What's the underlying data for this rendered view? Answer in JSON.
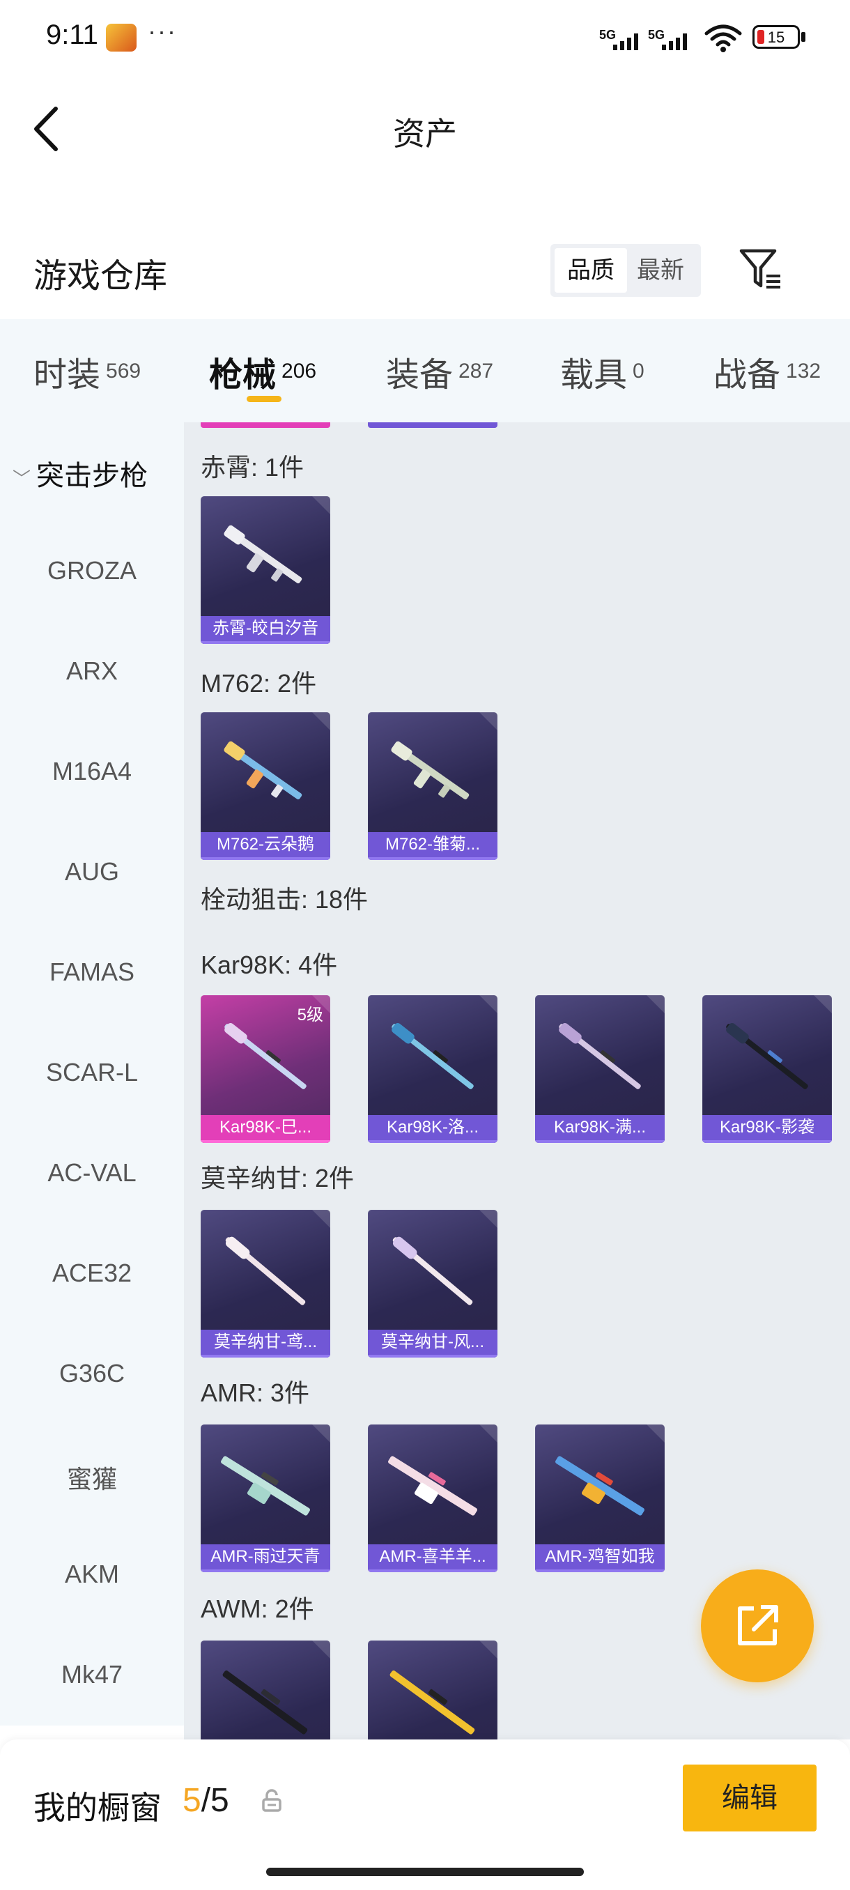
{
  "status_bar": {
    "time": "9:11",
    "more": "···",
    "net1": "5G",
    "net2": "5G",
    "battery": "15"
  },
  "header": {
    "title": "资产",
    "back_icon": "back-chevron-icon"
  },
  "section": {
    "title": "游戏仓库",
    "sort_options": [
      "品质",
      "最新"
    ],
    "selected_sort": "品质",
    "filter_icon": "filter-icon"
  },
  "tabs": [
    {
      "label": "时装",
      "count": "569"
    },
    {
      "label": "枪械",
      "count": "206"
    },
    {
      "label": "装备",
      "count": "287"
    },
    {
      "label": "载具",
      "count": "0"
    },
    {
      "label": "战备",
      "count": "132"
    }
  ],
  "active_tab": "枪械",
  "sidebar": {
    "category": "突击步枪",
    "items": [
      "GROZA",
      "ARX",
      "M16A4",
      "AUG",
      "FAMAS",
      "SCAR-L",
      "AC-VAL",
      "ACE32",
      "G36C",
      "蜜獾",
      "AKM",
      "Mk47"
    ]
  },
  "groups": [
    {
      "title": "赤霄: 1件",
      "items": [
        {
          "label": "赤霄-皎白汐音"
        }
      ]
    },
    {
      "title": "M762: 2件",
      "items": [
        {
          "label": "M762-云朵鹅"
        },
        {
          "label": "M762-雏菊..."
        }
      ]
    },
    {
      "title": "栓动狙击: 18件",
      "items": []
    },
    {
      "title": "Kar98K: 4件",
      "items": [
        {
          "label": "Kar98K-巳...",
          "level": "5级"
        },
        {
          "label": "Kar98K-洛..."
        },
        {
          "label": "Kar98K-满..."
        },
        {
          "label": "Kar98K-影袭"
        }
      ]
    },
    {
      "title": "莫辛纳甘: 2件",
      "items": [
        {
          "label": "莫辛纳甘-鸢..."
        },
        {
          "label": "莫辛纳甘-风..."
        }
      ]
    },
    {
      "title": "AMR: 3件",
      "items": [
        {
          "label": "AMR-雨过天青"
        },
        {
          "label": "AMR-喜羊羊..."
        },
        {
          "label": "AMR-鸡智如我"
        }
      ]
    },
    {
      "title": "AWM: 2件",
      "items": [
        {},
        {}
      ]
    }
  ],
  "bottom_bar": {
    "showcase_label": "我的橱窗",
    "showcase_current": "5",
    "showcase_total": "/5",
    "edit_label": "编辑"
  },
  "colors": {
    "accent": "#f8b60f",
    "rarity_purple": "#7157d6",
    "rarity_pink": "#e33fb8"
  }
}
